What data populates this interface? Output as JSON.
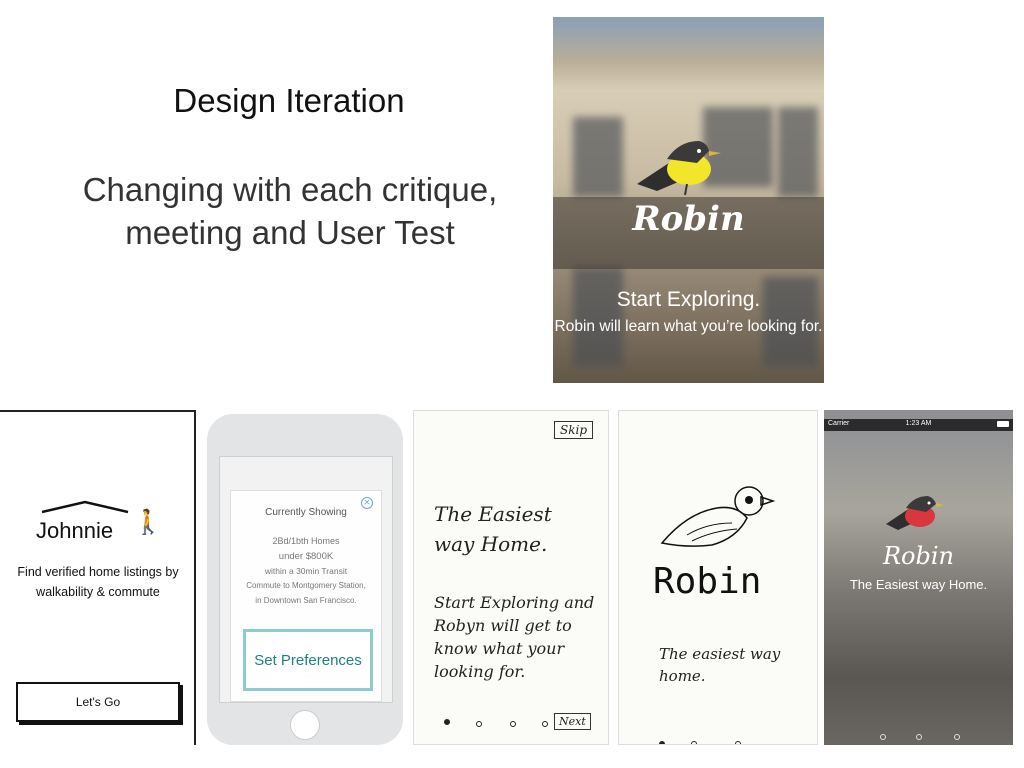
{
  "slide": {
    "title": "Design Iteration",
    "subtitle": "Changing with each critique, meeting and User Test"
  },
  "hero": {
    "logo": "Robin",
    "heading": "Start Exploring.",
    "body": "Robin will learn what you’re looking for."
  },
  "johnnie": {
    "name": "Johnnie",
    "tagline": "Find verified home listings by walkability & commute",
    "button": "Let's Go"
  },
  "wireframe": {
    "modal_title": "Currently Showing",
    "line1": "2Bd/1bth Homes",
    "line2": "under $800K",
    "line3": "within a 30min Transit",
    "line4": "Commute to Montgomery Station,",
    "line5": "in Downtown San Francisco.",
    "button": "Set Preferences"
  },
  "sketch1": {
    "skip": "Skip",
    "headline": "The Easiest way Home.",
    "body": "Start Exploring and Robyn will get to know what your looking for.",
    "next": "Next"
  },
  "sketch2": {
    "title": "Robin",
    "tagline": "The easiest way home."
  },
  "ios": {
    "carrier": "Carrier",
    "time": "1:23 AM",
    "logo": "Robin",
    "tagline": "The Easiest way Home."
  },
  "colors": {
    "robin_yellow": "#f2e62a",
    "robin_red": "#d9363e",
    "teal": "#1e7f86"
  }
}
